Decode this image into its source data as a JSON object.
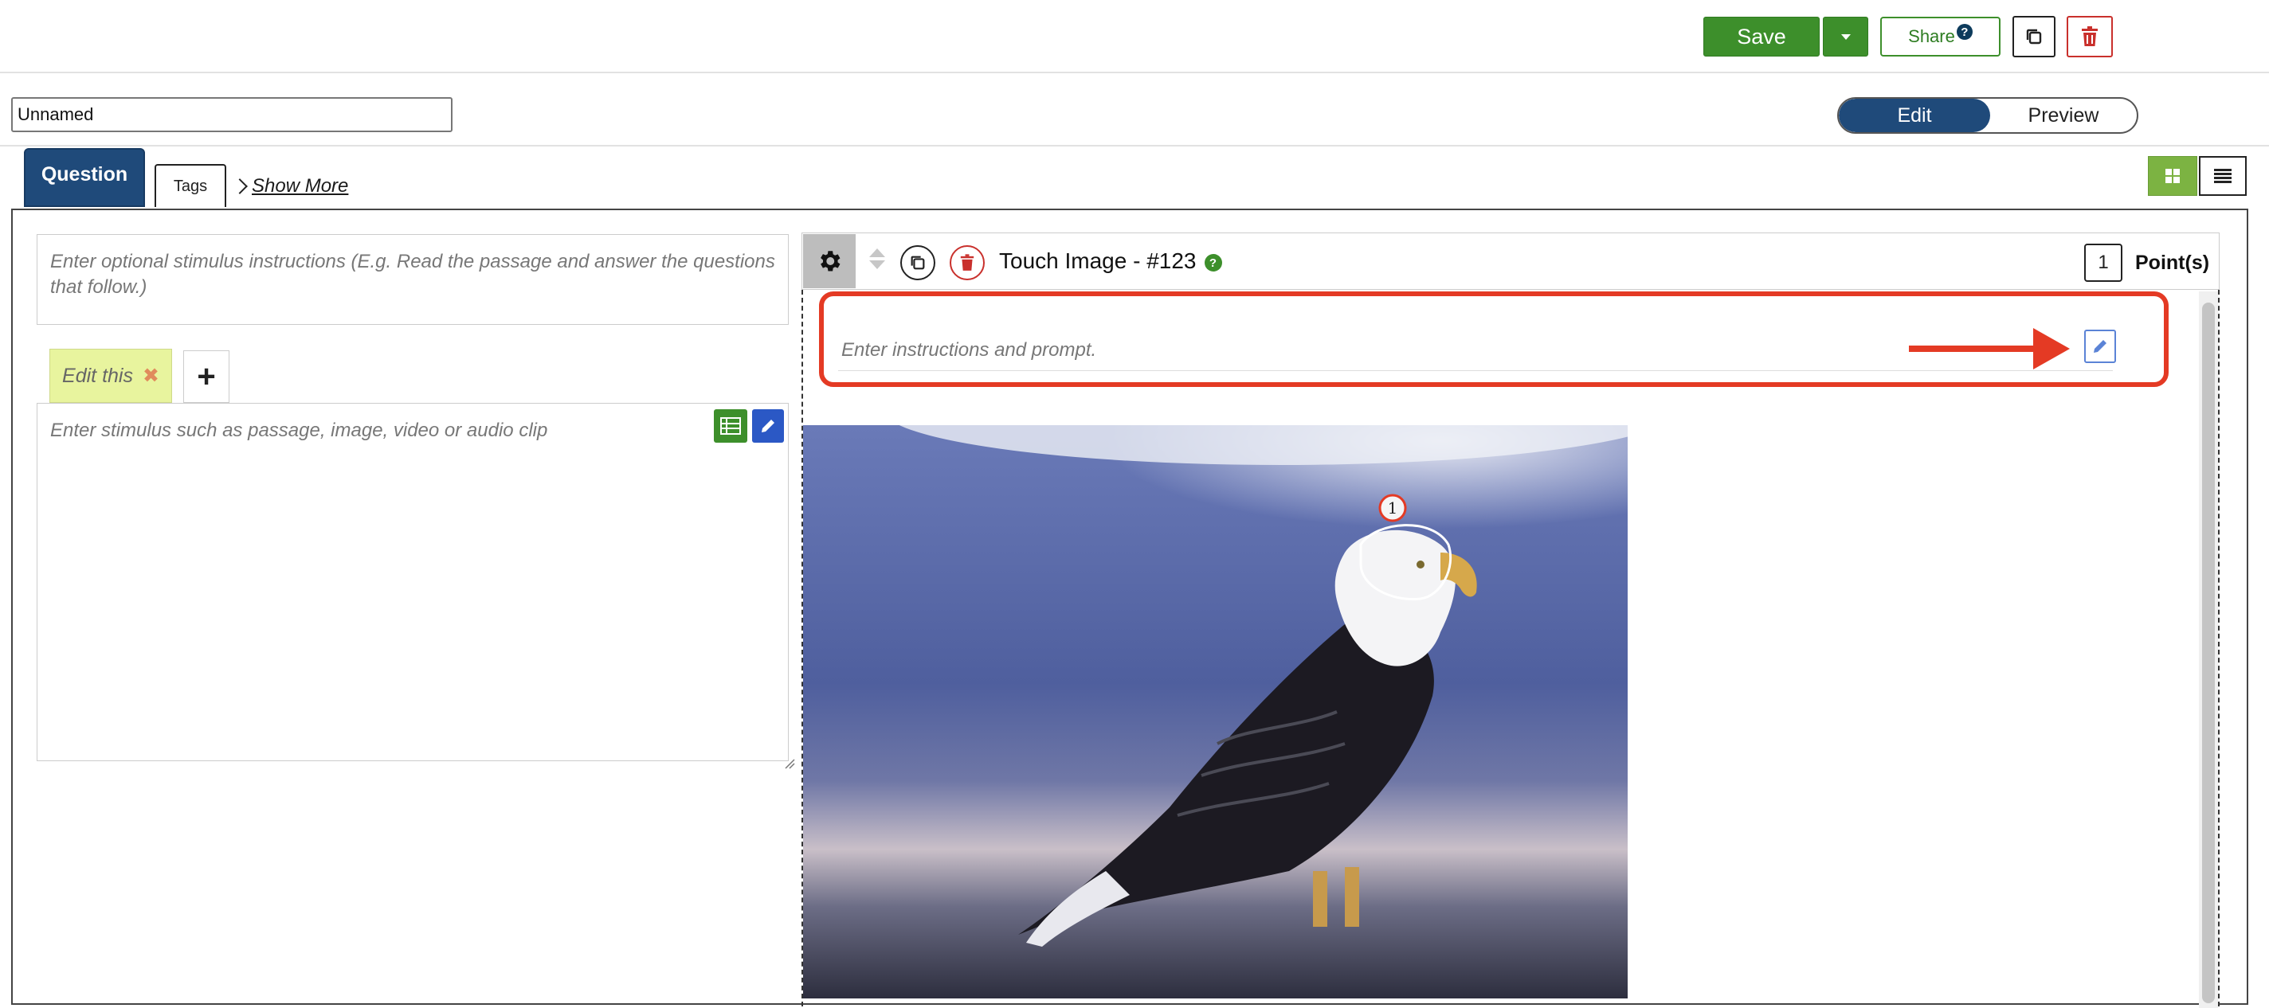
{
  "toolbar": {
    "save_label": "Save",
    "share_label": "Share",
    "share_help": "?",
    "copy_icon": "copy-icon",
    "delete_icon": "trash-icon"
  },
  "item": {
    "name_value": "Unnamed"
  },
  "mode_toggle": {
    "edit_label": "Edit",
    "preview_label": "Preview",
    "active": "Edit"
  },
  "tabs": {
    "question": "Question",
    "tags": "Tags",
    "show_more": "Show More"
  },
  "view_toggle": {
    "grid_icon": "grid-icon",
    "list_icon": "list-icon",
    "active": "grid"
  },
  "stimulus": {
    "instructions_placeholder": "Enter optional stimulus instructions (E.g. Read the passage and answer the questions that follow.)",
    "tab_label": "Edit this",
    "add_tab_label": "+",
    "content_placeholder": "Enter stimulus such as passage, image, video or audio clip"
  },
  "question": {
    "title": "Touch Image - #123",
    "help": "?",
    "points_value": "1",
    "points_label": "Point(s)",
    "prompt_placeholder": "Enter instructions and prompt.",
    "hotspot_number": "1",
    "image_alt": "Bald eagle"
  },
  "colors": {
    "save_green": "#3d8f2b",
    "toggle_active": "#1f4a7a",
    "highlight_red": "#e43a24",
    "delete_red": "#c9302c"
  }
}
